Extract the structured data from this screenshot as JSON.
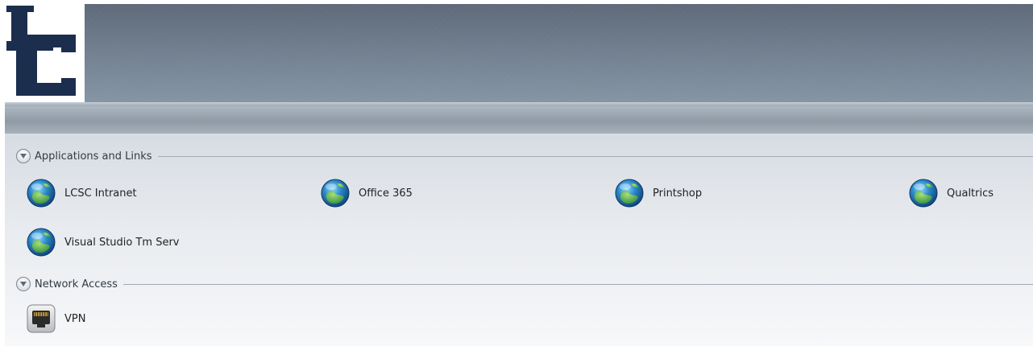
{
  "logo": {
    "letters": "LC"
  },
  "sections": [
    {
      "title": "Applications and Links",
      "items": [
        {
          "label": "LCSC Intranet",
          "icon": "globe-icon"
        },
        {
          "label": "Office 365",
          "icon": "globe-icon"
        },
        {
          "label": "Printshop",
          "icon": "globe-icon"
        },
        {
          "label": "Qualtrics",
          "icon": "globe-icon"
        },
        {
          "label": "Visual Studio Tm Serv",
          "icon": "globe-icon"
        }
      ]
    },
    {
      "title": "Network Access",
      "items": [
        {
          "label": "VPN",
          "icon": "network-port-icon"
        }
      ]
    }
  ],
  "colors": {
    "logo_navy": "#1b2e4e",
    "header": "#7d8d9d",
    "content_bg": "#e8ebef"
  }
}
